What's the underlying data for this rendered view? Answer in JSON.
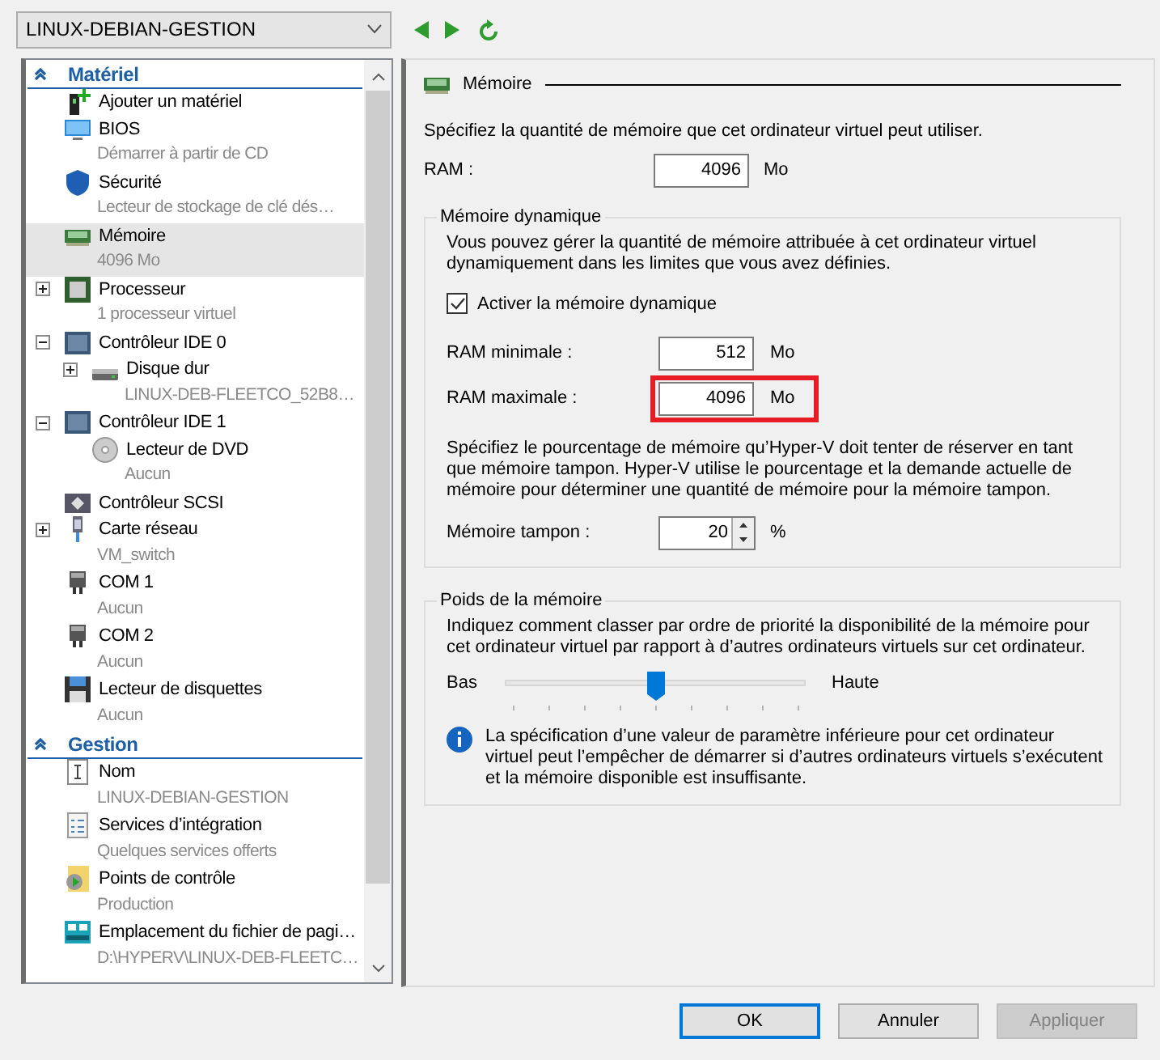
{
  "vm_selector": {
    "value": "LINUX-DEBIAN-GESTION"
  },
  "sections": [
    {
      "title": "Matériel",
      "expanded": true,
      "items": [
        {
          "label": "Ajouter un matériel",
          "kind": "add-hardware",
          "selected": false
        },
        {
          "label": "BIOS",
          "subtitle": "Démarrer à partir de CD",
          "kind": "monitor",
          "selected": false
        },
        {
          "label": "Sécurité",
          "subtitle": "Lecteur de stockage de clé dés…",
          "kind": "shield",
          "selected": false
        },
        {
          "label": "Mémoire",
          "subtitle": "4096 Mo",
          "kind": "memory",
          "selected": true
        },
        {
          "label": "Processeur",
          "subtitle": "1 processeur virtuel",
          "kind": "cpu",
          "selected": false,
          "expanded": false
        },
        {
          "label": "Contrôleur IDE 0",
          "kind": "controller",
          "selected": false,
          "expanded": true,
          "children": [
            {
              "label": "Disque dur",
              "subtitle": "LINUX-DEB-FLEETCO_52B8…",
              "kind": "disk",
              "selected": false,
              "expanded": false
            }
          ]
        },
        {
          "label": "Contrôleur IDE 1",
          "kind": "controller",
          "selected": false,
          "expanded": true,
          "children": [
            {
              "label": "Lecteur de DVD",
              "subtitle": "Aucun",
              "kind": "dvd",
              "selected": false
            }
          ]
        },
        {
          "label": "Contrôleur SCSI",
          "kind": "scsi",
          "selected": false
        },
        {
          "label": "Carte réseau",
          "subtitle": "VM_switch",
          "kind": "network",
          "selected": false,
          "expanded": false
        },
        {
          "label": "COM 1",
          "subtitle": "Aucun",
          "kind": "port",
          "selected": false
        },
        {
          "label": "COM 2",
          "subtitle": "Aucun",
          "kind": "port",
          "selected": false
        },
        {
          "label": "Lecteur de disquettes",
          "subtitle": "Aucun",
          "kind": "floppy",
          "selected": false
        }
      ]
    },
    {
      "title": "Gestion",
      "expanded": true,
      "items": [
        {
          "label": "Nom",
          "subtitle": "LINUX-DEBIAN-GESTION",
          "kind": "name",
          "selected": false
        },
        {
          "label": "Services d’intégration",
          "subtitle": "Quelques services offerts",
          "kind": "services",
          "selected": false
        },
        {
          "label": "Points de contrôle",
          "subtitle": "Production",
          "kind": "checkpoint",
          "selected": false
        },
        {
          "label": "Emplacement du fichier de pagi…",
          "subtitle": "D:\\HYPERV\\LINUX-DEB-FLEETC…",
          "kind": "paging",
          "selected": false
        }
      ]
    }
  ],
  "memory_panel": {
    "title": "Mémoire",
    "description": "Spécifiez la quantité de mémoire que cet ordinateur virtuel peut utiliser.",
    "ram": {
      "label": "RAM :",
      "value": "4096",
      "unit": "Mo"
    },
    "dynamic_memory": {
      "title": "Mémoire dynamique",
      "description": "Vous pouvez gérer la quantité de mémoire attribuée à cet ordinateur virtuel dynamiquement dans les limites que vous avez définies.",
      "enable": {
        "label": "Activer la mémoire dynamique",
        "checked": true
      },
      "min_ram": {
        "label": "RAM minimale :",
        "value": "512",
        "unit": "Mo"
      },
      "max_ram": {
        "label": "RAM maximale :",
        "value": "4096",
        "unit": "Mo",
        "highlighted": true
      },
      "buffer_description": "Spécifiez le pourcentage de mémoire qu’Hyper-V doit tenter de réserver en tant que mémoire tampon. Hyper-V utilise le pourcentage et la demande actuelle de mémoire pour déterminer une quantité de mémoire pour la mémoire tampon.",
      "buffer": {
        "label": "Mémoire tampon :",
        "value": "20",
        "unit": "%"
      }
    },
    "weight": {
      "title": "Poids de la mémoire",
      "description": "Indiquez comment classer par ordre de priorité la disponibilité de la mémoire pour cet ordinateur virtuel par rapport à d’autres ordinateurs virtuels sur cet ordinateur.",
      "low_label": "Bas",
      "high_label": "Haute",
      "level": 0.5,
      "note": "La spécification d’une valeur de paramètre inférieure pour cet ordinateur virtuel peut l’empêcher de démarrer si d’autres ordinateurs virtuels s’exécutent et la mémoire disponible est insuffisante."
    }
  },
  "buttons": [
    {
      "label": "OK",
      "kind": "default"
    },
    {
      "label": "Annuler",
      "kind": "normal"
    },
    {
      "label": "Appliquer",
      "kind": "disabled"
    }
  ]
}
